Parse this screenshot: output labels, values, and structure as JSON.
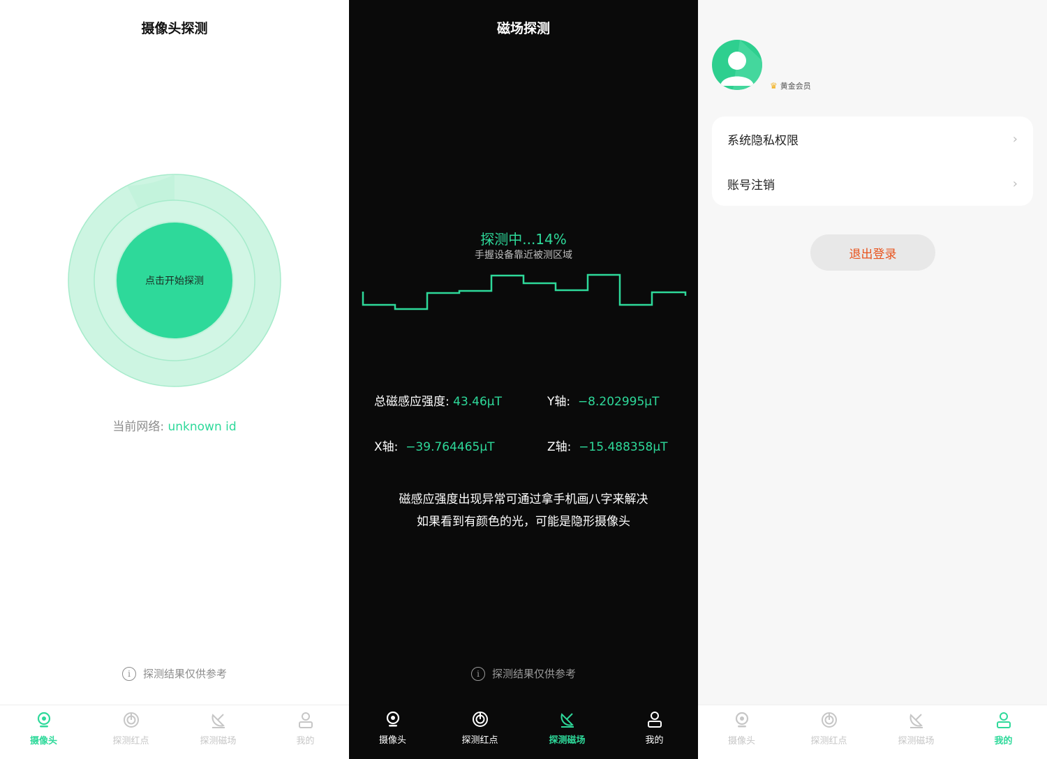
{
  "camera_screen": {
    "title": "摄像头探测",
    "scan_button": "点击开始探测",
    "network_label": "当前网络:",
    "network_value": "unknown id",
    "disclaimer": "探测结果仅供参考"
  },
  "magnetic_screen": {
    "title": "磁场探测",
    "status": "探测中...14%",
    "progress_percent": 14,
    "hint": "手握设备靠近被测区域",
    "total_label": "总磁感应强度:",
    "total_value": "43.46μT",
    "y_label": "Y轴:",
    "y_value": "−8.202995μT",
    "x_label": "X轴:",
    "x_value": "−39.764465μT",
    "z_label": "Z轴:",
    "z_value": "−15.488358μT",
    "tip_line1": "磁感应强度出现异常可通过拿手机画八字来解决",
    "tip_line2": "如果看到有颜色的光，可能是隐形摄像头",
    "disclaimer": "探测结果仅供参考"
  },
  "profile_screen": {
    "vip_label": "黄金会员",
    "menu": [
      "系统隐私权限",
      "账号注销"
    ],
    "logout": "退出登录"
  },
  "tabs": [
    "摄像头",
    "探测红点",
    "探测磁场",
    "我的"
  ],
  "colors": {
    "accent": "#2ed99a",
    "dark_bg": "#0a0a0a",
    "logout_text": "#e8531d"
  }
}
